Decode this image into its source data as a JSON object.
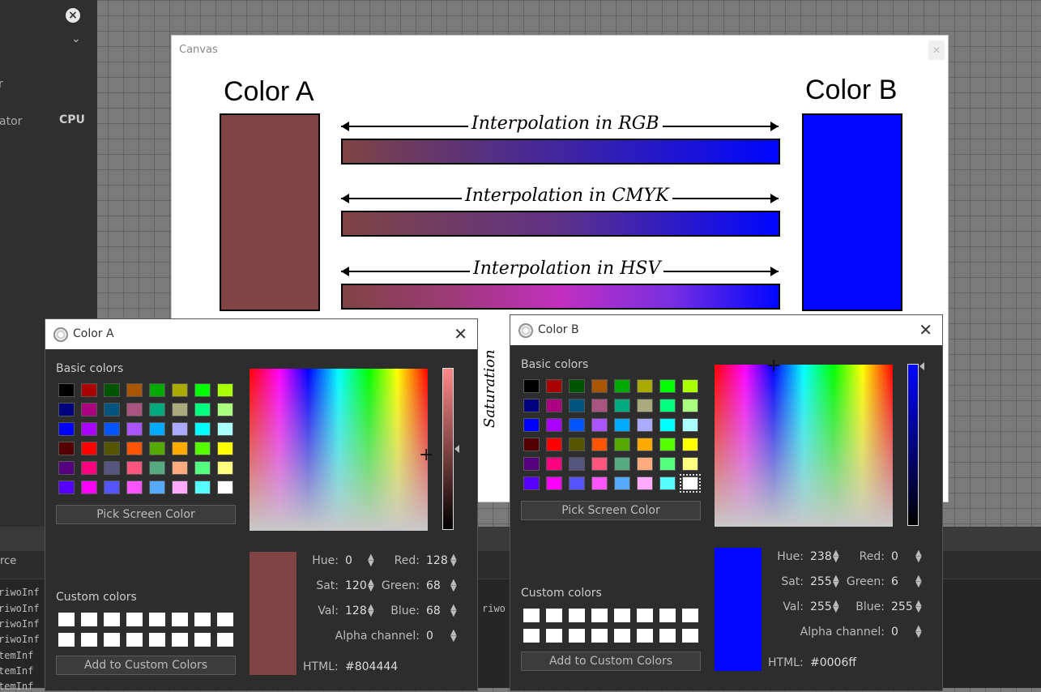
{
  "left_panel": {
    "chevron": "⌄",
    "text_r": "r",
    "text_ator": "ator",
    "cpu": "CPU"
  },
  "console": {
    "source_label": "rce",
    "lines": [
      "riwoInf",
      "riwoInf",
      "riwoInf",
      "riwoInf",
      "temInf",
      "temInf",
      "temInf"
    ],
    "riwo": "riwo"
  },
  "canvas": {
    "title": "Canvas",
    "color_a_label": "Color A",
    "color_b_label": "Color B",
    "interp_rgb": "Interpolation in RGB",
    "interp_cmyk": "Interpolation in CMYK",
    "interp_hsv": "Interpolation in HSV",
    "saturation": "Saturation",
    "color_a": "#804444",
    "color_b": "#0006ff"
  },
  "basic_colors": [
    "#000000",
    "#aa0000",
    "#005500",
    "#aa5500",
    "#00aa00",
    "#aaaa00",
    "#00ff00",
    "#aaff00",
    "#00007f",
    "#aa007f",
    "#00557f",
    "#aa557f",
    "#00aa7f",
    "#aaaa7f",
    "#00ff7f",
    "#aaff7f",
    "#0000ff",
    "#aa00ff",
    "#0055ff",
    "#aa55ff",
    "#00aaff",
    "#aaaaff",
    "#00ffff",
    "#aaffff",
    "#550000",
    "#ff0000",
    "#555500",
    "#ff5500",
    "#55aa00",
    "#ffaa00",
    "#55ff00",
    "#ffff00",
    "#55007f",
    "#ff007f",
    "#55557f",
    "#ff557f",
    "#55aa7f",
    "#ffaa7f",
    "#55ff7f",
    "#ffff7f",
    "#5500ff",
    "#ff00ff",
    "#5555ff",
    "#ff55ff",
    "#55aaff",
    "#ffaaff",
    "#55ffff",
    "#ffffff"
  ],
  "dialog_a": {
    "title": "Color A",
    "basic_label": "Basic colors",
    "pick_button": "Pick Screen Color",
    "custom_label": "Custom colors",
    "add_button": "Add to Custom Colors",
    "preview_color": "#804444",
    "hue_label": "Hue:",
    "hue": "0",
    "sat_label": "Sat:",
    "sat": "120",
    "val_label": "Val:",
    "val": "128",
    "red_label": "Red:",
    "red": "128",
    "green_label": "Green:",
    "green": "68",
    "blue_label": "Blue:",
    "blue": "68",
    "alpha_label": "Alpha channel:",
    "alpha": "0",
    "html_label": "HTML:",
    "html": "#804444"
  },
  "dialog_b": {
    "title": "Color B",
    "basic_label": "Basic colors",
    "pick_button": "Pick Screen Color",
    "custom_label": "Custom colors",
    "add_button": "Add to Custom Colors",
    "preview_color": "#0006ff",
    "hue_label": "Hue:",
    "hue": "238",
    "sat_label": "Sat:",
    "sat": "255",
    "val_label": "Val:",
    "val": "255",
    "red_label": "Red:",
    "red": "0",
    "green_label": "Green:",
    "green": "6",
    "blue_label": "Blue:",
    "blue": "255",
    "alpha_label": "Alpha channel:",
    "alpha": "0",
    "html_label": "HTML:",
    "html": "#0006ff"
  },
  "icons": {
    "close": "close-icon",
    "dialog": "color-wheel-icon",
    "spin": "spin-arrows-icon"
  }
}
